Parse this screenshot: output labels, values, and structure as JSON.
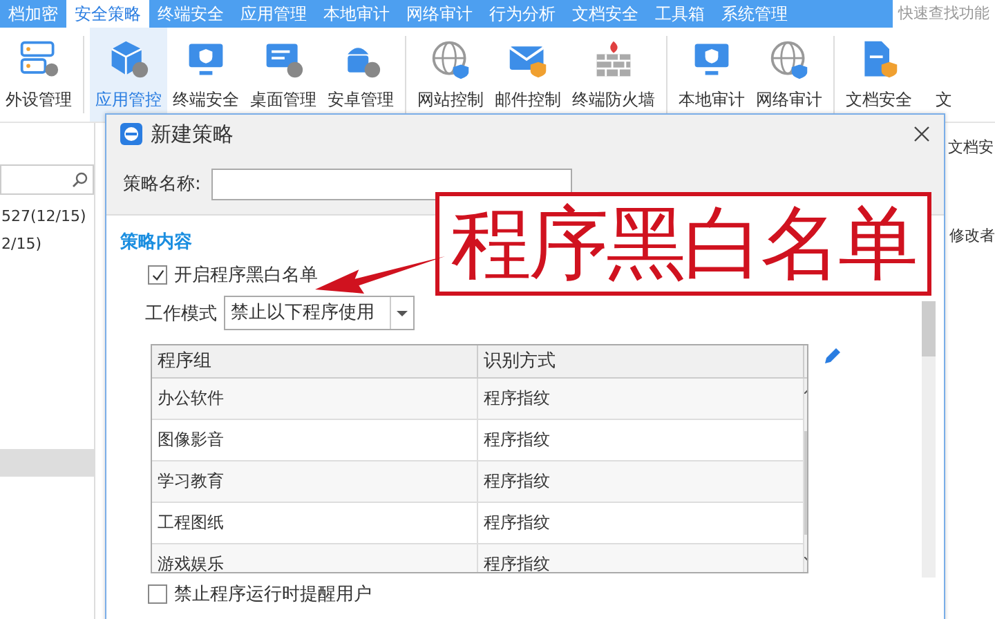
{
  "menu_bar": {
    "items": [
      {
        "label": "档加密",
        "selected": false
      },
      {
        "label": "安全策略",
        "selected": true
      },
      {
        "label": "终端安全",
        "selected": false
      },
      {
        "label": "应用管理",
        "selected": false
      },
      {
        "label": "本地审计",
        "selected": false
      },
      {
        "label": "网络审计",
        "selected": false
      },
      {
        "label": "行为分析",
        "selected": false
      },
      {
        "label": "文档安全",
        "selected": false
      },
      {
        "label": "工具箱",
        "selected": false
      },
      {
        "label": "系统管理",
        "selected": false
      }
    ],
    "search": {
      "placeholder": "快速查找功能"
    }
  },
  "toolbar": {
    "groups": [
      {
        "items": [
          {
            "label": "外设管理",
            "kind": "device",
            "selected": false
          }
        ]
      },
      {
        "items": [
          {
            "label": "应用管控",
            "kind": "cube",
            "selected": true
          },
          {
            "label": "终端安全",
            "kind": "monitor",
            "selected": false
          },
          {
            "label": "桌面管理",
            "kind": "desktop",
            "selected": false
          },
          {
            "label": "安卓管理",
            "kind": "android",
            "selected": false
          }
        ]
      },
      {
        "items": [
          {
            "label": "网站控制",
            "kind": "globe",
            "selected": false
          },
          {
            "label": "邮件控制",
            "kind": "mail",
            "selected": false
          },
          {
            "label": "终端防火墙",
            "kind": "wall",
            "selected": false
          }
        ]
      },
      {
        "items": [
          {
            "label": "本地审计",
            "kind": "monitor",
            "selected": false
          },
          {
            "label": "网络审计",
            "kind": "globe",
            "selected": false
          }
        ]
      },
      {
        "items": [
          {
            "label": "文档安全",
            "kind": "doc",
            "selected": false
          },
          {
            "label": "文",
            "kind": "none",
            "selected": false
          }
        ]
      }
    ]
  },
  "left_panel": {
    "items": [
      "527(12/15)",
      "2/15)"
    ]
  },
  "background": {
    "tab": "文档安",
    "column": "修改者"
  },
  "dialog": {
    "title": "新建策略",
    "name_label": "策略名称:",
    "section": "策略内容",
    "enable": {
      "label": "开启程序黑白名单",
      "checked": true
    },
    "mode": {
      "label": "工作模式",
      "value": "禁止以下程序使用"
    },
    "table": {
      "columns": [
        "程序组",
        "识别方式"
      ],
      "rows": [
        [
          "办公软件",
          "程序指纹"
        ],
        [
          "图像影音",
          "程序指纹"
        ],
        [
          "学习教育",
          "程序指纹"
        ],
        [
          "工程图纸",
          "程序指纹"
        ],
        [
          "游戏娱乐",
          "程序指纹"
        ]
      ]
    },
    "notify": {
      "label": "禁止程序运行时提醒用户",
      "checked": false
    }
  },
  "annotation": {
    "text": "程序黑白名单"
  }
}
